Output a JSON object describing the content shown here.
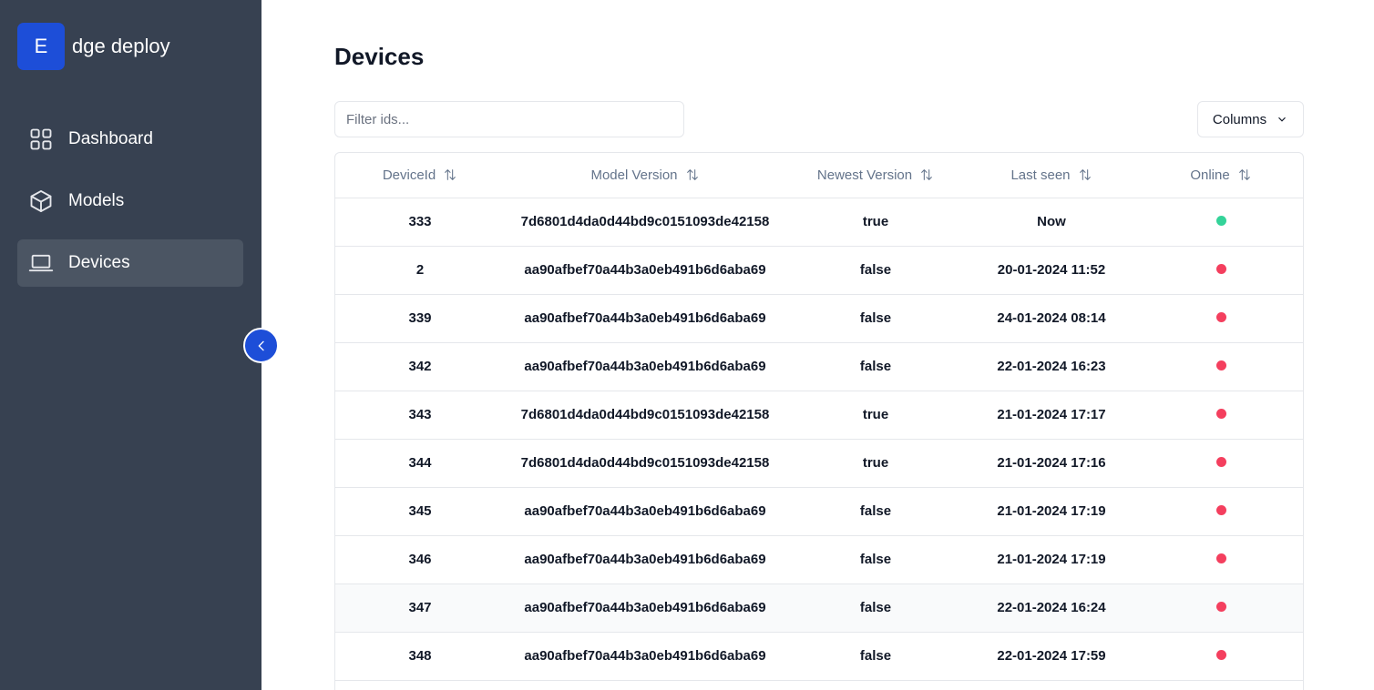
{
  "brand": {
    "logo_letter": "E",
    "name": "dge deploy",
    "color": "#1d4ed8"
  },
  "sidebar": {
    "items": [
      {
        "label": "Dashboard",
        "icon": "dashboard-grid-icon",
        "active": false
      },
      {
        "label": "Models",
        "icon": "cube-icon",
        "active": false
      },
      {
        "label": "Devices",
        "icon": "laptop-icon",
        "active": true
      }
    ],
    "collapse_icon": "chevron-left-icon"
  },
  "page": {
    "title": "Devices",
    "filter_placeholder": "Filter ids...",
    "columns_label": "Columns"
  },
  "table": {
    "headers": [
      "DeviceId",
      "Model Version",
      "Newest Version",
      "Last seen",
      "Online"
    ],
    "rows": [
      {
        "id": "333",
        "model": "7d6801d4da0d44bd9c0151093de42158",
        "newest": "true",
        "last_seen": "Now",
        "online": true
      },
      {
        "id": "2",
        "model": "aa90afbef70a44b3a0eb491b6d6aba69",
        "newest": "false",
        "last_seen": "20-01-2024 11:52",
        "online": false
      },
      {
        "id": "339",
        "model": "aa90afbef70a44b3a0eb491b6d6aba69",
        "newest": "false",
        "last_seen": "24-01-2024 08:14",
        "online": false
      },
      {
        "id": "342",
        "model": "aa90afbef70a44b3a0eb491b6d6aba69",
        "newest": "false",
        "last_seen": "22-01-2024 16:23",
        "online": false
      },
      {
        "id": "343",
        "model": "7d6801d4da0d44bd9c0151093de42158",
        "newest": "true",
        "last_seen": "21-01-2024 17:17",
        "online": false
      },
      {
        "id": "344",
        "model": "7d6801d4da0d44bd9c0151093de42158",
        "newest": "true",
        "last_seen": "21-01-2024 17:16",
        "online": false
      },
      {
        "id": "345",
        "model": "aa90afbef70a44b3a0eb491b6d6aba69",
        "newest": "false",
        "last_seen": "21-01-2024 17:19",
        "online": false
      },
      {
        "id": "346",
        "model": "aa90afbef70a44b3a0eb491b6d6aba69",
        "newest": "false",
        "last_seen": "21-01-2024 17:19",
        "online": false
      },
      {
        "id": "347",
        "model": "aa90afbef70a44b3a0eb491b6d6aba69",
        "newest": "false",
        "last_seen": "22-01-2024 16:24",
        "online": false
      },
      {
        "id": "348",
        "model": "aa90afbef70a44b3a0eb491b6d6aba69",
        "newest": "false",
        "last_seen": "22-01-2024 17:59",
        "online": false
      }
    ],
    "status_colors": {
      "online": "#34d399",
      "offline": "#f43f5e"
    }
  }
}
